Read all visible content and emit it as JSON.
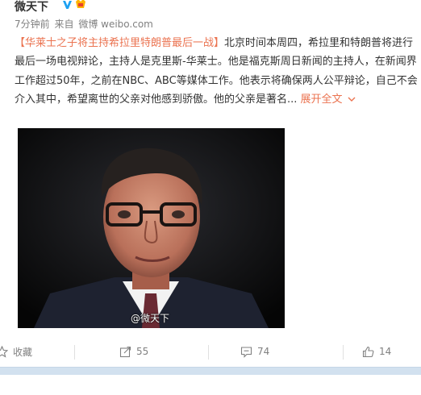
{
  "header": {
    "username": "微天下",
    "verify_icon": "verified-v-icon",
    "vip_icon": "vip-badge-icon",
    "time": "7分钟前",
    "source_prefix": "来自",
    "source": "微博 weibo.com"
  },
  "post": {
    "topic": "【华莱士之子将主持希拉里特朗普最后一战】",
    "body": "北京时间本周四，希拉里和特朗普将进行最后一场电视辩论，主持人是克里斯-华莱士。他是福克斯周日新闻的主持人，在新闻界工作超过50年，之前在NBC、ABC等媒体工作。他表示将确保两人公平辩论，自己不会介入其中，希望离世的父亲对他感到骄傲。他的父亲是著名...",
    "expand_label": "展开全文"
  },
  "media": {
    "watermark": "@微天下"
  },
  "actions": {
    "favorite_label": "收藏",
    "repost_count": "55",
    "comment_count": "74",
    "like_count": "14"
  },
  "colors": {
    "accent": "#eb7350",
    "meta": "#808080",
    "text": "#333333",
    "bar": "#d2e1ef"
  }
}
